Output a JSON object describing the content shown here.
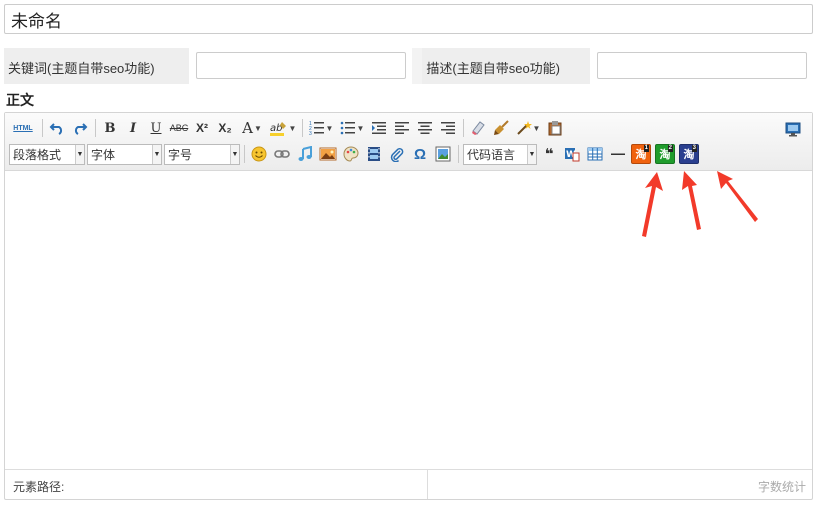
{
  "title_field": {
    "value": "未命名"
  },
  "meta": {
    "keywords_label": "关键词(主题自带seo功能)",
    "keywords_value": "",
    "description_label": "描述(主题自带seo功能)",
    "description_value": ""
  },
  "body_label": "正文",
  "toolbar": {
    "html_label": "HTML",
    "bold": "B",
    "italic": "I",
    "underline": "U",
    "strike": "ABC",
    "superscript": "X²",
    "subscript": "X₂",
    "font_color": "A",
    "paragraph_select": "段落格式",
    "font_family_select": "字体",
    "font_size_select": "字号",
    "code_lang_select": "代码语言",
    "quote": "❝",
    "omega": "Ω",
    "taobao_buttons": [
      {
        "label": "淘",
        "badge": "1",
        "color": "#f0620e"
      },
      {
        "label": "淘",
        "badge": "2",
        "color": "#1f9c2c"
      },
      {
        "label": "淘",
        "badge": "3",
        "color": "#2a3f8f"
      }
    ]
  },
  "status": {
    "path_label": "元素路径:",
    "word_count_label": "字数统计"
  },
  "colors": {
    "arrow": "#f23a2a",
    "accent_blue": "#2a6fb4"
  }
}
